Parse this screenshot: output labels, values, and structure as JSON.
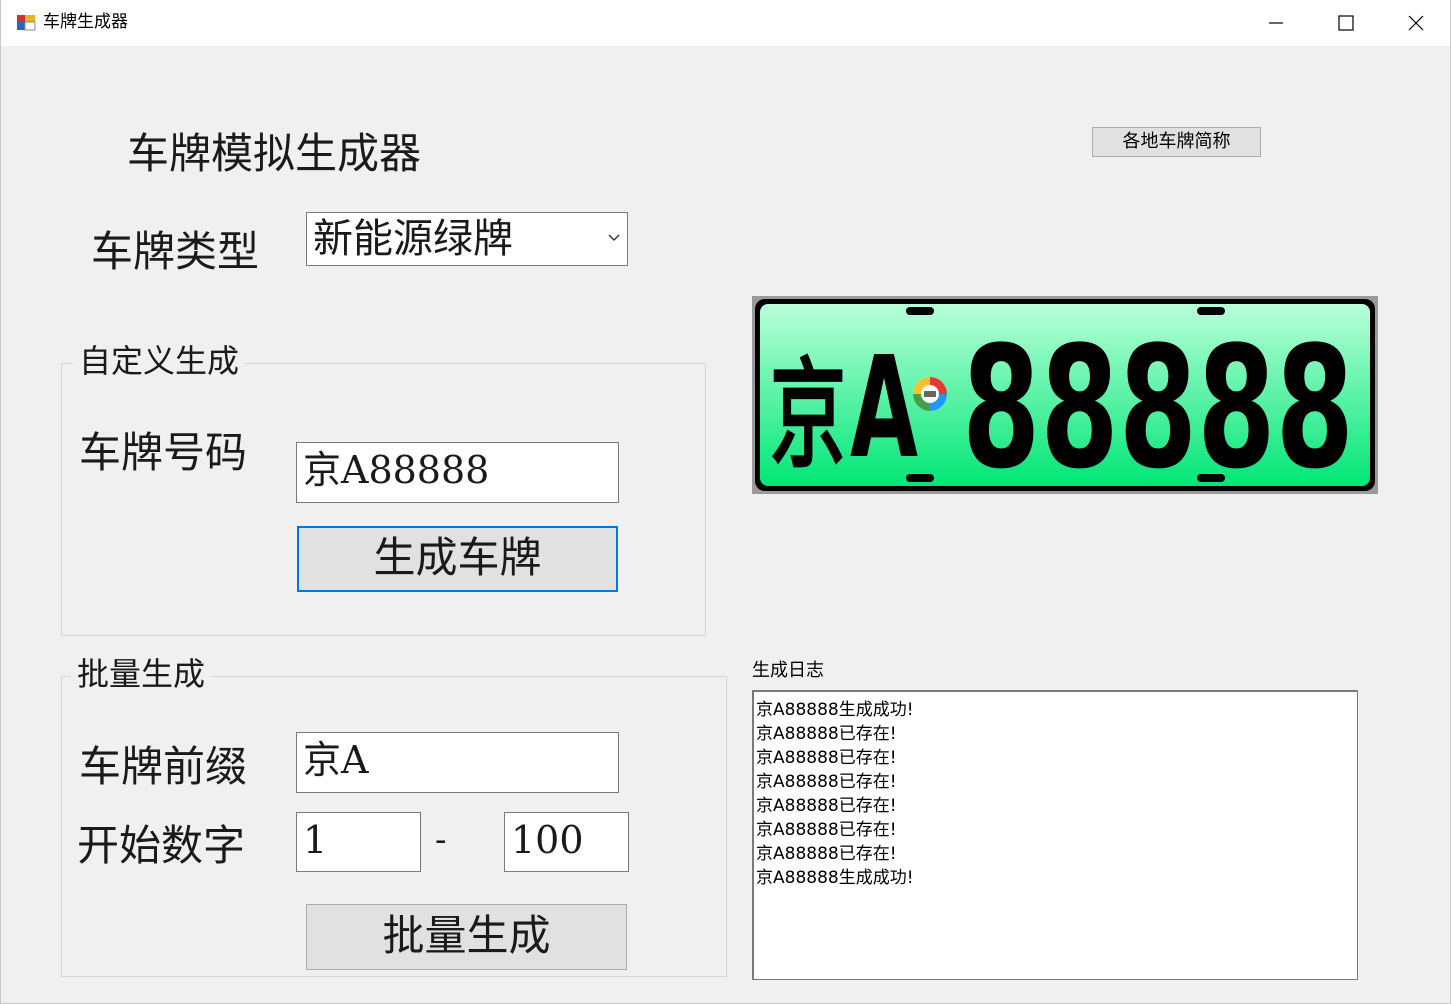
{
  "window": {
    "title": "车牌生成器"
  },
  "header": {
    "main_title": "车牌模拟生成器",
    "region_button": "各地车牌简称"
  },
  "plate_type": {
    "label": "车牌类型",
    "selected": "新能源绿牌"
  },
  "custom": {
    "legend": "自定义生成",
    "plate_label": "车牌号码",
    "plate_value": "京A88888",
    "generate_button": "生成车牌"
  },
  "batch": {
    "legend": "批量生成",
    "prefix_label": "车牌前缀",
    "prefix_value": "京A",
    "start_label": "开始数字",
    "start_value": "1",
    "separator": "-",
    "end_value": "100",
    "batch_button": "批量生成"
  },
  "preview": {
    "province": "京",
    "letter": "A",
    "digits": "88888",
    "colors": {
      "top": "#b9ffd9",
      "bottom": "#00e676",
      "text": "#000000"
    }
  },
  "log": {
    "label": "生成日志",
    "lines": [
      "京A88888生成成功!",
      "京A88888已存在!",
      "京A88888已存在!",
      "京A88888已存在!",
      "京A88888已存在!",
      "京A88888已存在!",
      "京A88888已存在!",
      "京A88888生成成功!"
    ]
  },
  "icons": {
    "minimize": "minimize-icon",
    "maximize": "maximize-icon",
    "close": "close-icon",
    "dropdown": "chevron-down-icon"
  }
}
